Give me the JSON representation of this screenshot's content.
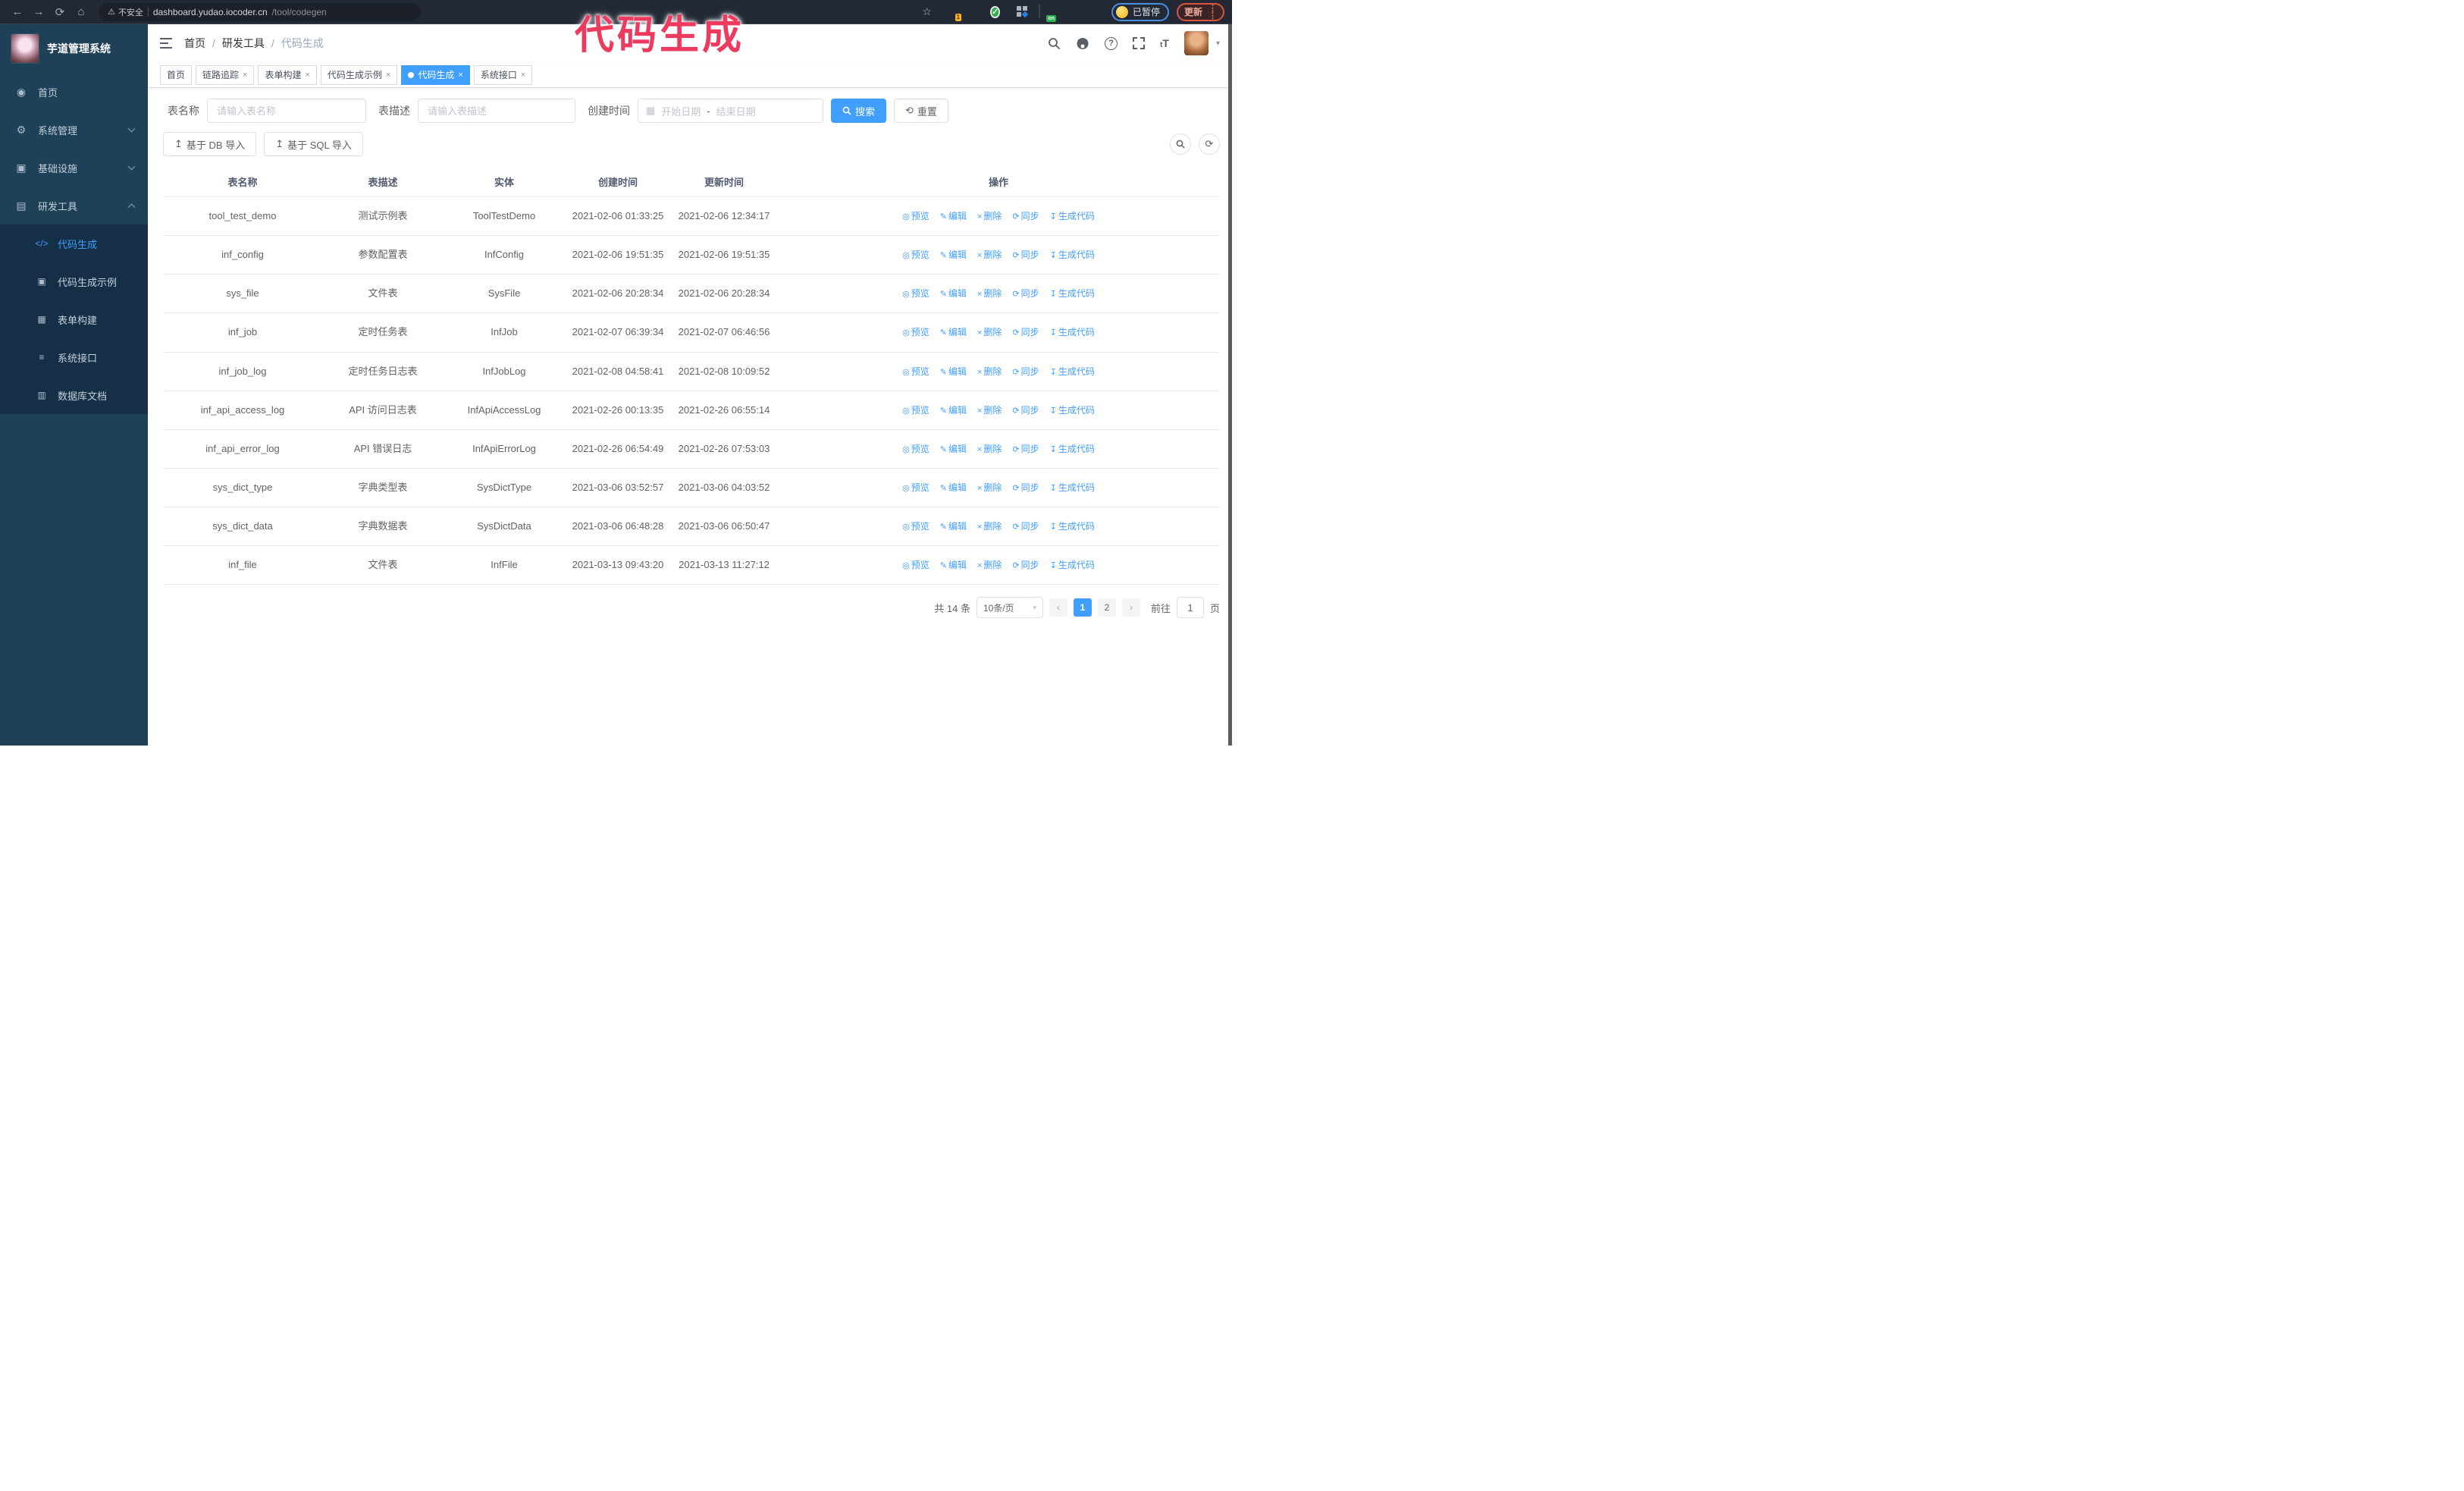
{
  "browser": {
    "security_label": "不安全",
    "url_host": "dashboard.yudao.iocoder.cn",
    "url_path": "/tool/codegen",
    "extension_count_badge": "1",
    "extension_on_badge": "on",
    "paused_badge": "已暂停",
    "update_button": "更新"
  },
  "annotation": {
    "text": "代码生成",
    "color": "#ef3a60"
  },
  "sidebar": {
    "app_title": "芋道管理系统",
    "items": [
      {
        "label": "首页"
      },
      {
        "label": "系统管理"
      },
      {
        "label": "基础设施"
      },
      {
        "label": "研发工具"
      }
    ],
    "sub_items": [
      {
        "label": "代码生成"
      },
      {
        "label": "代码生成示例"
      },
      {
        "label": "表单构建"
      },
      {
        "label": "系统接口"
      },
      {
        "label": "数据库文档"
      }
    ]
  },
  "header": {
    "breadcrumb": [
      "首页",
      "研发工具",
      "代码生成"
    ]
  },
  "tabs": [
    {
      "label": "首页"
    },
    {
      "label": "链路追踪"
    },
    {
      "label": "表单构建"
    },
    {
      "label": "代码生成示例"
    },
    {
      "label": "代码生成"
    },
    {
      "label": "系统接口"
    }
  ],
  "filters": {
    "name_label": "表名称",
    "name_placeholder": "请输入表名称",
    "desc_label": "表描述",
    "desc_placeholder": "请输入表描述",
    "time_label": "创建时间",
    "start_placeholder": "开始日期",
    "range_separator": "-",
    "end_placeholder": "结束日期",
    "search_button": "搜索",
    "reset_button": "重置"
  },
  "toolbar": {
    "import_db": "基于 DB 导入",
    "import_sql": "基于 SQL 导入"
  },
  "table": {
    "columns": [
      "表名称",
      "表描述",
      "实体",
      "创建时间",
      "更新时间",
      "操作"
    ],
    "actions": [
      "预览",
      "编辑",
      "删除",
      "同步",
      "生成代码"
    ],
    "rows": [
      {
        "name": "tool_test_demo",
        "desc": "测试示例表",
        "entity": "ToolTestDemo",
        "created": "2021-02-06 01:33:25",
        "updated": "2021-02-06 12:34:17"
      },
      {
        "name": "inf_config",
        "desc": "参数配置表",
        "entity": "InfConfig",
        "created": "2021-02-06 19:51:35",
        "updated": "2021-02-06 19:51:35"
      },
      {
        "name": "sys_file",
        "desc": "文件表",
        "entity": "SysFile",
        "created": "2021-02-06 20:28:34",
        "updated": "2021-02-06 20:28:34"
      },
      {
        "name": "inf_job",
        "desc": "定时任务表",
        "entity": "InfJob",
        "created": "2021-02-07 06:39:34",
        "updated": "2021-02-07 06:46:56"
      },
      {
        "name": "inf_job_log",
        "desc": "定时任务日志表",
        "entity": "InfJobLog",
        "created": "2021-02-08 04:58:41",
        "updated": "2021-02-08 10:09:52"
      },
      {
        "name": "inf_api_access_log",
        "desc": "API 访问日志表",
        "entity": "InfApiAccessLog",
        "created": "2021-02-26 00:13:35",
        "updated": "2021-02-26 06:55:14"
      },
      {
        "name": "inf_api_error_log",
        "desc": "API 错误日志",
        "entity": "InfApiErrorLog",
        "created": "2021-02-26 06:54:49",
        "updated": "2021-02-26 07:53:03"
      },
      {
        "name": "sys_dict_type",
        "desc": "字典类型表",
        "entity": "SysDictType",
        "created": "2021-03-06 03:52:57",
        "updated": "2021-03-06 04:03:52"
      },
      {
        "name": "sys_dict_data",
        "desc": "字典数据表",
        "entity": "SysDictData",
        "created": "2021-03-06 06:48:28",
        "updated": "2021-03-06 06:50:47"
      },
      {
        "name": "inf_file",
        "desc": "文件表",
        "entity": "InfFile",
        "created": "2021-03-13 09:43:20",
        "updated": "2021-03-13 11:27:12"
      }
    ]
  },
  "pagination": {
    "total": "共 14 条",
    "page_size": "10条/页",
    "page_1": "1",
    "page_2": "2",
    "goto_label": "前往",
    "goto_value": "1",
    "page_unit": "页"
  },
  "icons": {
    "back": "←",
    "forward": "→",
    "reload": "⟳",
    "home": "⌂",
    "warning": "⚠",
    "star": "☆",
    "menu_home": "◉",
    "menu_system": "⚙",
    "menu_infra": "▣",
    "menu_tools": "▤",
    "sub_codegen": "</>",
    "sub_demo": "▣",
    "sub_form": "▦",
    "sub_api": "≡",
    "sub_db": "▥",
    "calendar": "▦",
    "reset": "⟲",
    "import": "↥",
    "refresh": "⟳",
    "op_preview": "◎",
    "op_edit": "✎",
    "op_delete": "×",
    "op_sync": "⟳",
    "op_generate": "↧",
    "caret_down": "▾",
    "prev": "‹",
    "next": "›",
    "text_size": "tT"
  },
  "colors": {
    "accent": "#409eff",
    "sidebar_bg": "#1f4158",
    "submenu_bg": "#152f47",
    "annotation": "#ef3a60",
    "tag_active": "#409eff"
  }
}
